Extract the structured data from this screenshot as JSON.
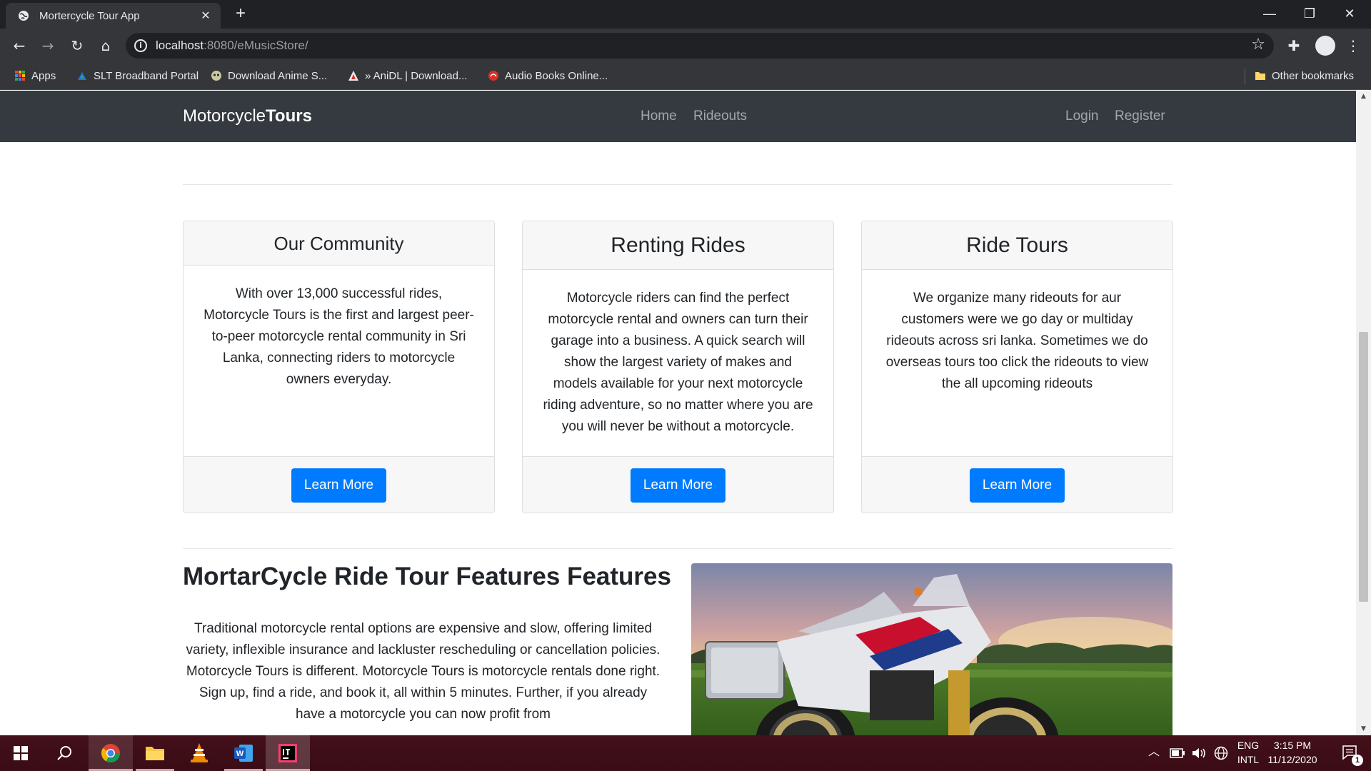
{
  "browser": {
    "tab_title": "Mortercycle Tour App",
    "url_host": "localhost",
    "url_path": ":8080/eMusicStore/",
    "bookmarks": [
      {
        "label": "Apps"
      },
      {
        "label": "SLT Broadband Portal"
      },
      {
        "label": "Download Anime S..."
      },
      {
        "label": "» AniDL | Download..."
      },
      {
        "label": "Audio Books Online..."
      }
    ],
    "other_bookmarks": "Other bookmarks"
  },
  "navbar": {
    "brand_light": "Motorcycle",
    "brand_bold": "Tours",
    "links": [
      "Home",
      "Rideouts"
    ],
    "right_links": [
      "Login",
      "Register"
    ]
  },
  "cards": [
    {
      "title": "Our Community",
      "body": "With over 13,000 successful rides, Motorcycle Tours is the first and largest peer-to-peer motorcycle rental community in Sri Lanka, connecting riders to motorcycle owners everyday.",
      "button": "Learn More"
    },
    {
      "title": "Renting Rides",
      "body": "Motorcycle riders can find the perfect motorcycle rental and owners can turn their garage into a business. A quick search will show the largest variety of makes and models available for your next motorcycle riding adventure, so no matter where you are you will never be without a motorcycle.",
      "button": "Learn More"
    },
    {
      "title": "Ride Tours",
      "body": "We organize many rideouts for aur customers were we go day or multiday rideouts across sri lanka. Sometimes we do overseas tours too click the rideouts to view the all upcoming rideouts",
      "button": "Learn More"
    }
  ],
  "features": {
    "title": "MortarCycle Ride Tour Features Features",
    "text": "Traditional motorcycle rental options are expensive and slow, offering limited variety, inflexible insurance and lackluster rescheduling or cancellation policies. Motorcycle Tours is different. Motorcycle Tours is motorcycle rentals done right. Sign up, find a ride, and book it, all within 5 minutes. Further, if you already have a motorcycle you can now profit from"
  },
  "taskbar": {
    "lang_top": "ENG",
    "lang_bottom": "INTL",
    "time": "3:15 PM",
    "date": "11/12/2020",
    "notification_count": "1"
  },
  "colors": {
    "navbar_bg": "#343a40",
    "primary": "#007bff",
    "browser_dark": "#202124",
    "browser_toolbar": "#35363a",
    "taskbar": "#3f0d12"
  }
}
